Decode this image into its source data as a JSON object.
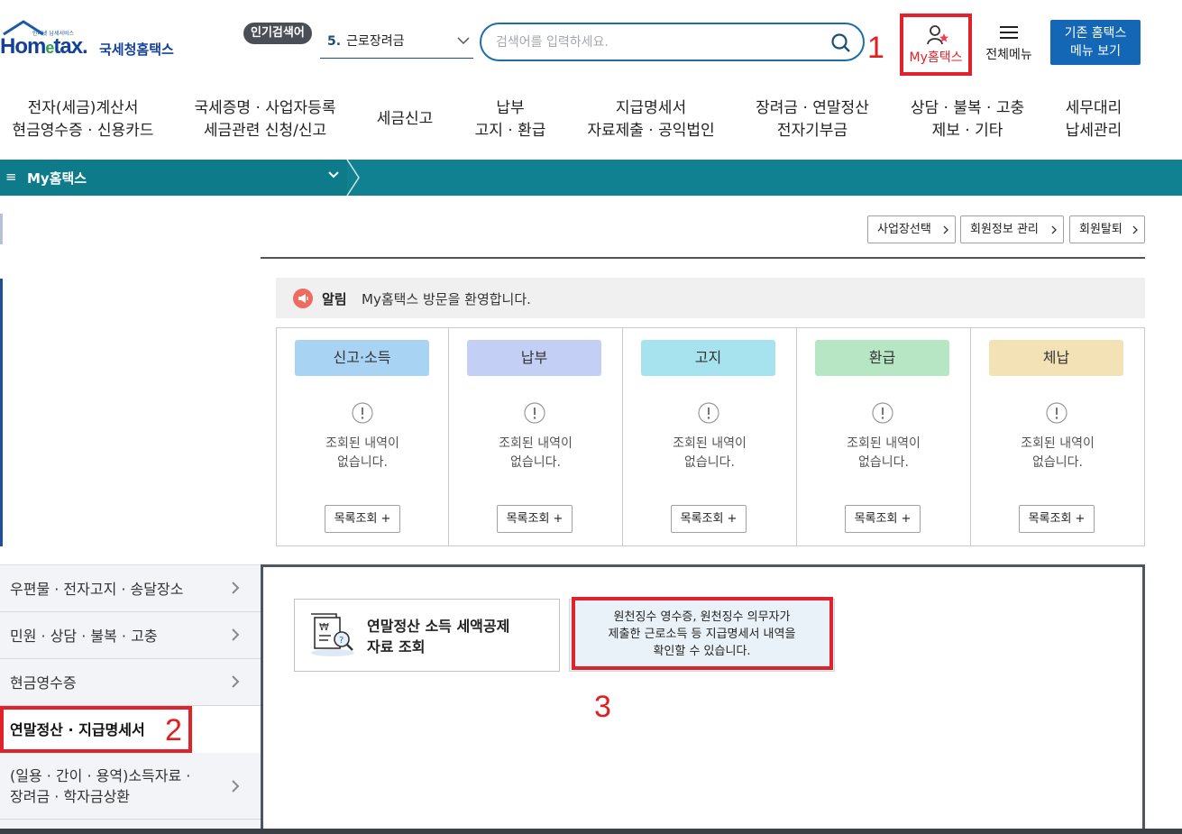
{
  "header": {
    "logo_small": "인터넷 납세서비스",
    "logo_brand_1": "Hom",
    "logo_brand_e": "e",
    "logo_brand_2": "tax.",
    "logo_sub": "국세청홈택스",
    "popular_badge": "인기검색어",
    "popular_rank": "5.",
    "popular_term": "근로장려금",
    "search_placeholder": "검색어를 입력하세요.",
    "myhome_label": "My홈택스",
    "allmenu_label": "전체메뉴",
    "legacy_label": "기존 홈택스\n메뉴 보기"
  },
  "annotations": [
    "1",
    "2",
    "3"
  ],
  "nav": [
    {
      "line1": "전자(세금)계산서",
      "line2": "현금영수증 · 신용카드"
    },
    {
      "line1": "국세증명 · 사업자등록",
      "line2": "세금관련 신청/신고"
    },
    {
      "line1": "세금신고",
      "line2": ""
    },
    {
      "line1": "납부",
      "line2": "고지 · 환급"
    },
    {
      "line1": "지급명세서",
      "line2": "자료제출 · 공익법인"
    },
    {
      "line1": "장려금 · 연말정산",
      "line2": "전자기부금"
    },
    {
      "line1": "상담 · 불복 · 고충",
      "line2": "제보 · 기타"
    },
    {
      "line1": "세무대리",
      "line2": "납세관리"
    }
  ],
  "breadcrumb": {
    "hamburger": "≡",
    "title": "My홈택스"
  },
  "top_buttons": [
    "사업장선택",
    "회원정보 관리",
    "회원탈퇴"
  ],
  "notice": {
    "label": "알림",
    "message": "My홈택스 방문을 환영합니다."
  },
  "cards": [
    {
      "title": "신고·소득",
      "color": "#a9d3f2",
      "empty": "조회된 내역이\n없습니다.",
      "button": "목록조회 +"
    },
    {
      "title": "납부",
      "color": "#c3cff5",
      "empty": "조회된 내역이\n없습니다.",
      "button": "목록조회 +"
    },
    {
      "title": "고지",
      "color": "#a6e3ef",
      "empty": "조회된 내역이\n없습니다.",
      "button": "목록조회 +"
    },
    {
      "title": "환급",
      "color": "#b7e6c5",
      "empty": "조회된 내역이\n없습니다.",
      "button": "목록조회 +"
    },
    {
      "title": "체납",
      "color": "#f3e2b6",
      "empty": "조회된 내역이\n없습니다.",
      "button": "목록조회 +"
    }
  ],
  "side_menu": [
    {
      "label": "우편물 · 전자고지 · 송달장소"
    },
    {
      "label": "민원 · 상담 · 불복 · 고충"
    },
    {
      "label": "현금영수증"
    },
    {
      "label": "연말정산 · 지급명세서"
    },
    {
      "label_1": "(일용 · 간이 · 용역)소득자료 ·",
      "label_2": "장려금 · 학자금상환"
    }
  ],
  "feature": {
    "title": "연말정산 소득 세액공제\n자료 조회"
  },
  "tip": {
    "text": "원천징수 영수증, 원천징수 의무자가\n제출한 근로소득 등 지급명세서 내역을\n확인할 수 있습니다."
  },
  "colors": {
    "teal": "#0f8191",
    "brand_blue": "#12409a",
    "accent_red": "#e0232b",
    "legacy_btn": "#1467b4"
  }
}
